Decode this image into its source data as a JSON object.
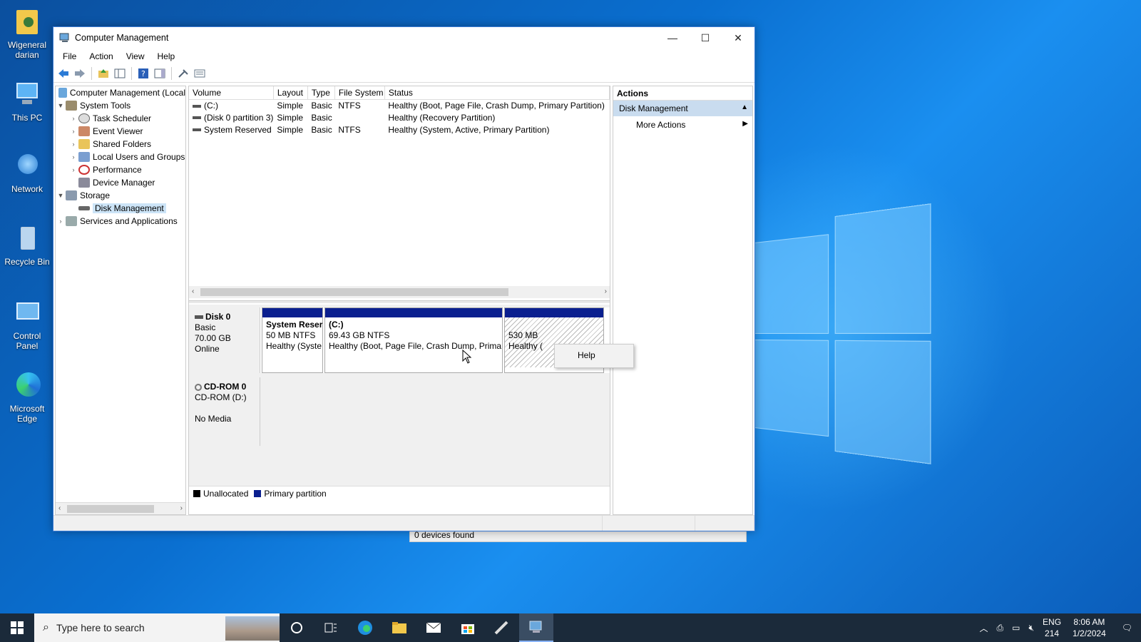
{
  "desktop": {
    "icons": [
      {
        "label": "Wigeneral darian"
      },
      {
        "label": "This PC"
      },
      {
        "label": "Network"
      },
      {
        "label": "Recycle Bin"
      },
      {
        "label": "Control Panel"
      },
      {
        "label": "Microsoft Edge"
      }
    ]
  },
  "window": {
    "title": "Computer Management",
    "controls": {
      "minimize": "—",
      "maximize": "☐",
      "close": "✕"
    },
    "menu": [
      "File",
      "Action",
      "View",
      "Help"
    ]
  },
  "tree": {
    "root": "Computer Management (Local",
    "items": [
      {
        "label": "System Tools",
        "expanded": true
      },
      {
        "label": "Task Scheduler"
      },
      {
        "label": "Event Viewer"
      },
      {
        "label": "Shared Folders"
      },
      {
        "label": "Local Users and Groups"
      },
      {
        "label": "Performance"
      },
      {
        "label": "Device Manager"
      },
      {
        "label": "Storage",
        "expanded": true
      },
      {
        "label": "Disk Management",
        "selected": true
      },
      {
        "label": "Services and Applications"
      }
    ]
  },
  "volume_table": {
    "columns": [
      "Volume",
      "Layout",
      "Type",
      "File System",
      "Status"
    ],
    "rows": [
      [
        "(C:)",
        "Simple",
        "Basic",
        "NTFS",
        "Healthy (Boot, Page File, Crash Dump, Primary Partition)"
      ],
      [
        "(Disk 0 partition 3)",
        "Simple",
        "Basic",
        "",
        "Healthy (Recovery Partition)"
      ],
      [
        "System Reserved",
        "Simple",
        "Basic",
        "NTFS",
        "Healthy (System, Active, Primary Partition)"
      ]
    ]
  },
  "disks": {
    "disk0": {
      "name": "Disk 0",
      "type": "Basic",
      "size": "70.00 GB",
      "state": "Online",
      "partitions": [
        {
          "name": "System Reser",
          "size": "50 MB NTFS",
          "status": "Healthy (Syste"
        },
        {
          "name": "(C:)",
          "size": "69.43 GB NTFS",
          "status": "Healthy (Boot, Page File, Crash Dump, Primar"
        },
        {
          "name": "",
          "size": "530 MB",
          "status": "Healthy ("
        }
      ]
    },
    "cdrom0": {
      "name": "CD-ROM 0",
      "type": "CD-ROM (D:)",
      "state": "No Media"
    }
  },
  "legend": {
    "unallocated": "Unallocated",
    "primary": "Primary partition"
  },
  "context_menu": {
    "item": "Help"
  },
  "actions": {
    "header": "Actions",
    "section": "Disk Management",
    "more": "More Actions"
  },
  "device_popup": {
    "text": "0 devices found"
  },
  "taskbar": {
    "search_placeholder": "Type here to search",
    "lang": "ENG",
    "lang_sub": "214",
    "time": "8:06 AM",
    "date": "1/2/2024"
  }
}
